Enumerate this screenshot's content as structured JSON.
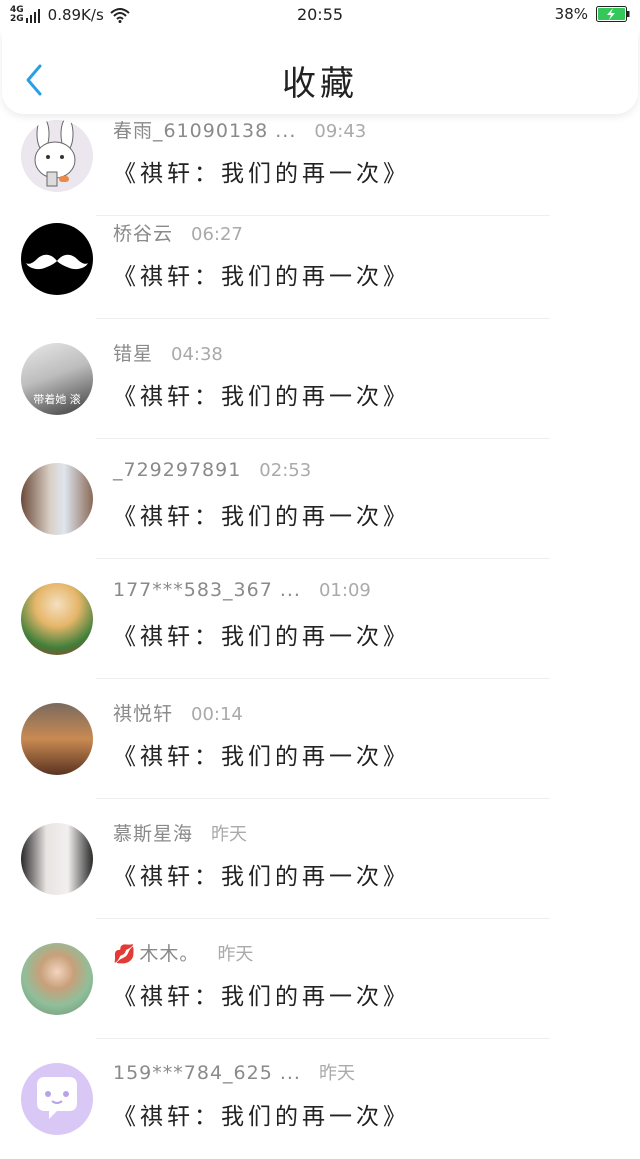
{
  "status_bar": {
    "net_type_top": "4G",
    "net_type_bottom": "2G",
    "net_speed": "0.89K/s",
    "time": "20:55",
    "battery_percent": "38%",
    "icons": [
      "signal-icon",
      "wifi-icon",
      "battery-charging-icon"
    ]
  },
  "header": {
    "title": "收藏",
    "back_icon": "chevron-left-icon"
  },
  "colors": {
    "accent": "#2a9fe6",
    "battery_green": "#34c759",
    "name_gray": "#8a8a8a",
    "time_gray": "#aaaaaa"
  },
  "items": [
    {
      "name": "春雨_61090138 ...",
      "time": "09:43",
      "song": "《祺轩：我们的再一次》",
      "avatar": "rabbit-avatar"
    },
    {
      "name": "桥谷云",
      "time": "06:27",
      "song": "《祺轩：我们的再一次》",
      "avatar": "mustache-avatar"
    },
    {
      "name": "错星",
      "time": "04:38",
      "song": "《祺轩：我们的再一次》",
      "avatar": "photo-avatar",
      "avatar_caption": "带着她 滚"
    },
    {
      "name": "_729297891",
      "time": "02:53",
      "song": "《祺轩：我们的再一次》",
      "avatar": "photo-avatar"
    },
    {
      "name": "177***583_367 ...",
      "time": "01:09",
      "song": "《祺轩：我们的再一次》",
      "avatar": "photo-avatar"
    },
    {
      "name": "祺悦轩",
      "time": "00:14",
      "song": "《祺轩：我们的再一次》",
      "avatar": "photo-avatar"
    },
    {
      "name": "慕斯星海",
      "time": "昨天",
      "song": "《祺轩：我们的再一次》",
      "avatar": "photo-avatar"
    },
    {
      "name": "木木。",
      "time": "昨天",
      "song": "《祺轩：我们的再一次》",
      "avatar": "photo-avatar",
      "name_icon": "lips-icon"
    },
    {
      "name": "159***784_625 ...",
      "time": "昨天",
      "song": "《祺轩：我们的再一次》",
      "avatar": "chat-bubble-avatar"
    }
  ]
}
